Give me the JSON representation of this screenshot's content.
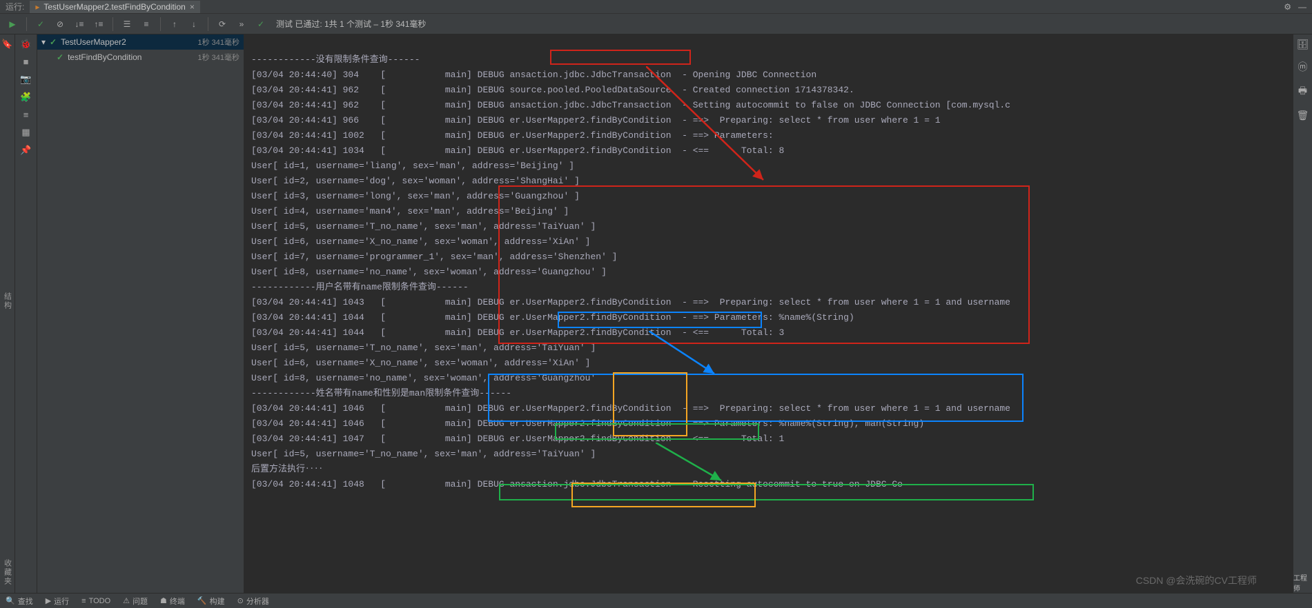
{
  "top": {
    "run_label": "运行:",
    "tab_title": "TestUserMapper2.testFindByCondition"
  },
  "toolbar_status": "测试 已通过: 1共 1 个测试 – 1秒 341毫秒",
  "tree": {
    "root": {
      "name": "TestUserMapper2",
      "dur": "1秒 341毫秒"
    },
    "child": {
      "name": "testFindByCondition",
      "dur": "1秒 341毫秒"
    }
  },
  "sidebar_v": "结构",
  "sidebar_v2": "收藏夹",
  "console_lines": [
    "",
    "------------没有限制条件查询------",
    "[03/04 20:44:40] 304    [           main] DEBUG ansaction.jdbc.JdbcTransaction  - Opening JDBC Connection",
    "[03/04 20:44:41] 962    [           main] DEBUG source.pooled.PooledDataSource  - Created connection 1714378342.",
    "[03/04 20:44:41] 962    [           main] DEBUG ansaction.jdbc.JdbcTransaction  - Setting autocommit to false on JDBC Connection [com.mysql.c",
    "[03/04 20:44:41] 966    [           main] DEBUG er.UserMapper2.findByCondition  - ==>  Preparing: select * from user where 1 = 1",
    "[03/04 20:44:41] 1002   [           main] DEBUG er.UserMapper2.findByCondition  - ==> Parameters: ",
    "[03/04 20:44:41] 1034   [           main] DEBUG er.UserMapper2.findByCondition  - <==      Total: 8",
    "User[ id=1, username='liang', sex='man', address='Beijing' ]",
    "User[ id=2, username='dog', sex='woman', address='ShangHai' ]",
    "User[ id=3, username='long', sex='man', address='Guangzhou' ]",
    "User[ id=4, username='man4', sex='man', address='Beijing' ]",
    "User[ id=5, username='T_no_name', sex='man', address='TaiYuan' ]",
    "User[ id=6, username='X_no_name', sex='woman', address='XiAn' ]",
    "User[ id=7, username='programmer_1', sex='man', address='Shenzhen' ]",
    "User[ id=8, username='no_name', sex='woman', address='Guangzhou' ]",
    "------------用户名带有name限制条件查询------",
    "[03/04 20:44:41] 1043   [           main] DEBUG er.UserMapper2.findByCondition  - ==>  Preparing: select * from user where 1 = 1 and username",
    "[03/04 20:44:41] 1044   [           main] DEBUG er.UserMapper2.findByCondition  - ==> Parameters: %name%(String)",
    "[03/04 20:44:41] 1044   [           main] DEBUG er.UserMapper2.findByCondition  - <==      Total: 3",
    "User[ id=5, username='T_no_name', sex='man', address='TaiYuan' ]",
    "User[ id=6, username='X_no_name', sex='woman', address='XiAn' ]",
    "User[ id=8, username='no_name', sex='woman', address='Guangzhou'",
    "------------姓名带有name和性别是man限制条件查询------",
    "[03/04 20:44:41] 1046   [           main] DEBUG er.UserMapper2.findByCondition  - ==>  Preparing: select * from user where 1 = 1 and username",
    "[03/04 20:44:41] 1046   [           main] DEBUG er.UserMapper2.findByCondition  - ==> Parameters: %name%(String), man(String)",
    "[03/04 20:44:41] 1047   [           main] DEBUG er.UserMapper2.findByCondition  - <==      Total: 1",
    "User[ id=5, username='T_no_name', sex='man', address='TaiYuan' ]",
    "后置方法执行‥‥",
    "[03/04 20:44:41] 1048   [           main] DEBUG ansaction.jdbc.JdbcTransaction  - Resetting autocommit to true on JDBC Co"
  ],
  "status": {
    "search": "查找",
    "run": "运行",
    "todo": "TODO",
    "problems": "问题",
    "terminal": "终端",
    "build": "构建",
    "profiler": "分析器"
  },
  "watermark": "CSDN @会洗碗的CV工程师",
  "right_watermark": "工程师"
}
